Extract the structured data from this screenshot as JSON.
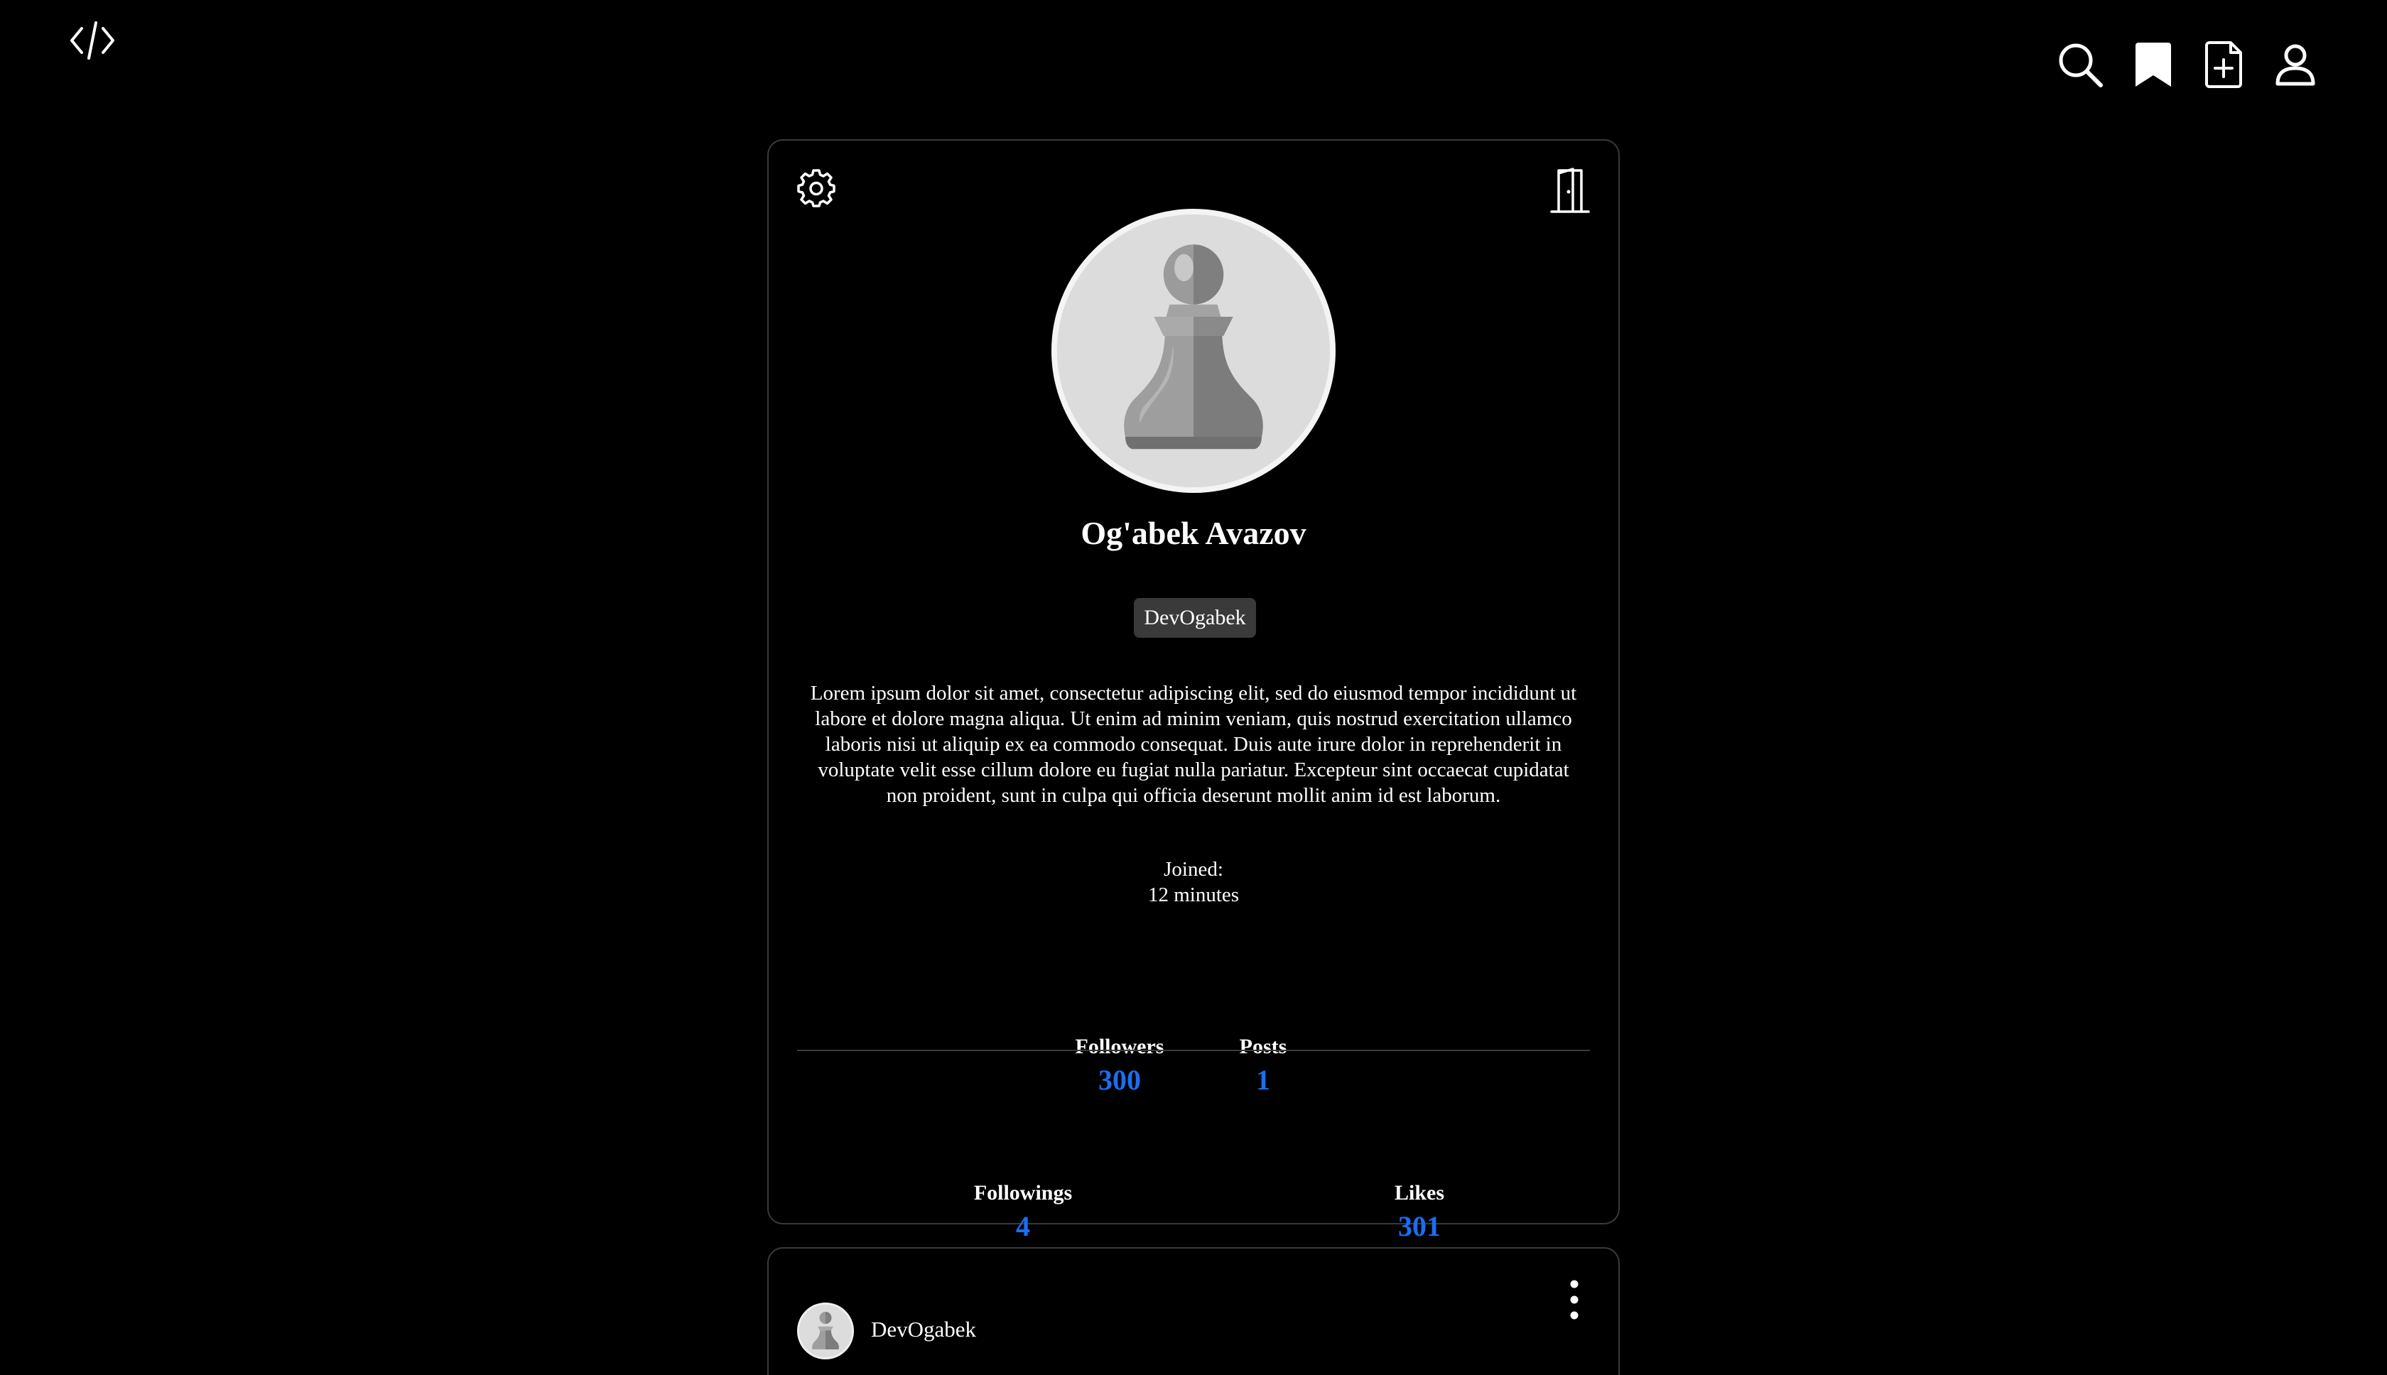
{
  "header": {
    "logo_icon": "code-brackets-icon",
    "icons": [
      "search-icon",
      "bookmark-icon",
      "add-file-icon",
      "user-icon"
    ]
  },
  "profile": {
    "settings_icon": "gear-icon",
    "logout_icon": "door-icon",
    "avatar_icon": "chess-pawn-icon",
    "name": "Og'abek Avazov",
    "username": "DevOgabek",
    "bio": "Lorem ipsum dolor sit amet, consectetur adipiscing elit, sed do eiusmod tempor incididunt ut labore et dolore magna aliqua. Ut enim ad minim veniam, quis nostrud exercitation ullamco laboris nisi ut aliquip ex ea commodo consequat. Duis aute irure dolor in reprehenderit in voluptate velit esse cillum dolore eu fugiat nulla pariatur. Excepteur sint occaecat cupidatat non proident, sunt in culpa qui officia deserunt mollit anim id est laborum.",
    "joined_label": "Joined:",
    "joined_value": "12 minutes",
    "stats": {
      "followers_label": "Followers",
      "followers_value": "300",
      "posts_label": "Posts",
      "posts_value": "1",
      "followings_label": "Followings",
      "followings_value": "4",
      "likes_label": "Likes",
      "likes_value": "301"
    }
  },
  "post": {
    "author": "DevOgabek",
    "menu_icon": "more-vertical-icon"
  },
  "colors": {
    "background": "#000000",
    "accent": "#1a6ef2",
    "border": "#3a3a3a",
    "badge": "#3a3a3a"
  }
}
